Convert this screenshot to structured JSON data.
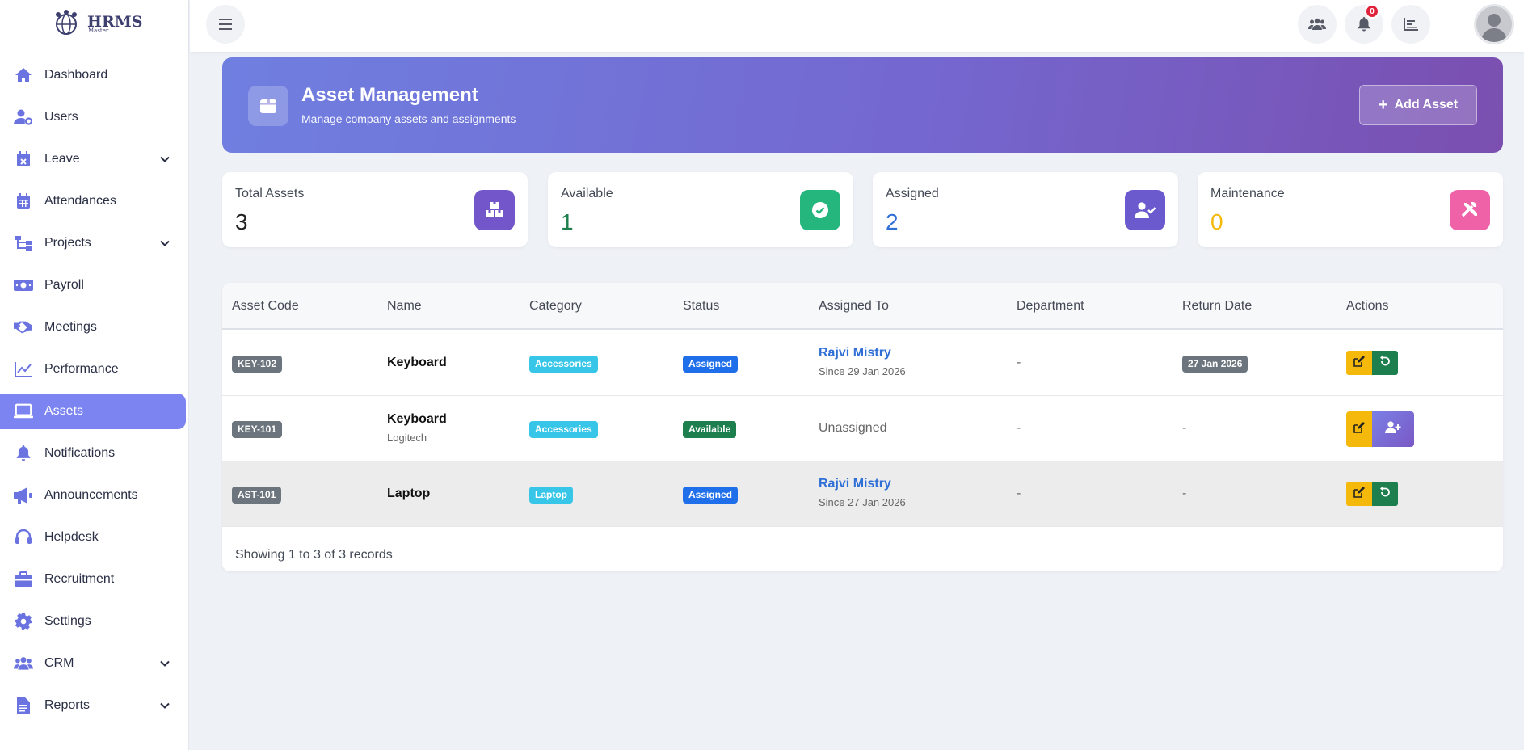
{
  "app": {
    "logo_text": "HRMS",
    "logo_sub": "Master"
  },
  "sidebar": {
    "items": [
      {
        "label": "Dashboard",
        "icon": "home-icon",
        "expandable": false
      },
      {
        "label": "Users",
        "icon": "user-gear-icon",
        "expandable": false
      },
      {
        "label": "Leave",
        "icon": "calendar-x-icon",
        "expandable": true
      },
      {
        "label": "Attendances",
        "icon": "calendar-icon",
        "expandable": false
      },
      {
        "label": "Projects",
        "icon": "sitemap-icon",
        "expandable": true
      },
      {
        "label": "Payroll",
        "icon": "money-icon",
        "expandable": false
      },
      {
        "label": "Meetings",
        "icon": "handshake-icon",
        "expandable": false
      },
      {
        "label": "Performance",
        "icon": "line-chart-icon",
        "expandable": false
      },
      {
        "label": "Assets",
        "icon": "laptop-icon",
        "expandable": false,
        "active": true
      },
      {
        "label": "Notifications",
        "icon": "bell-icon",
        "expandable": false
      },
      {
        "label": "Announcements",
        "icon": "megaphone-icon",
        "expandable": false
      },
      {
        "label": "Helpdesk",
        "icon": "headset-icon",
        "expandable": false
      },
      {
        "label": "Recruitment",
        "icon": "briefcase-icon",
        "expandable": false
      },
      {
        "label": "Settings",
        "icon": "gear-icon",
        "expandable": false
      },
      {
        "label": "CRM",
        "icon": "users-icon",
        "expandable": true
      },
      {
        "label": "Reports",
        "icon": "file-icon",
        "expandable": true
      }
    ]
  },
  "topbar": {
    "notification_count": "0"
  },
  "header": {
    "title": "Asset Management",
    "subtitle": "Manage company assets and assignments",
    "add_button": "Add Asset"
  },
  "stats": [
    {
      "label": "Total Assets",
      "value": "3",
      "color": "#222222",
      "icon": "boxes-icon",
      "icon_bg": "#7356c9"
    },
    {
      "label": "Available",
      "value": "1",
      "color": "#1e7f4e",
      "icon": "check-circle-icon",
      "icon_bg": "#24b67c"
    },
    {
      "label": "Assigned",
      "value": "2",
      "color": "#2f6fd6",
      "icon": "user-check-icon",
      "icon_bg": "#6a5acd"
    },
    {
      "label": "Maintenance",
      "value": "0",
      "color": "#f5b90b",
      "icon": "tools-icon",
      "icon_bg": "#f062a8"
    }
  ],
  "table": {
    "headers": [
      "Asset Code",
      "Name",
      "Category",
      "Status",
      "Assigned To",
      "Department",
      "Return Date",
      "Actions"
    ],
    "rows": [
      {
        "code": "KEY-102",
        "name": "Keyboard",
        "sub": "",
        "category": "Accessories",
        "status": "Assigned",
        "assigned_to": "Rajvi Mistry",
        "since": "Since 29 Jan 2026",
        "department": "-",
        "return_date": "27 Jan 2026"
      },
      {
        "code": "KEY-101",
        "name": "Keyboard",
        "sub": "Logitech",
        "category": "Accessories",
        "status": "Available",
        "assigned_to": "Unassigned",
        "since": "",
        "department": "-",
        "return_date": "-"
      },
      {
        "code": "AST-101",
        "name": "Laptop",
        "sub": "",
        "category": "Laptop",
        "status": "Assigned",
        "assigned_to": "Rajvi Mistry",
        "since": "Since 27 Jan 2026",
        "department": "-",
        "return_date": "-"
      }
    ],
    "footer": "Showing 1 to 3 of 3 records"
  }
}
